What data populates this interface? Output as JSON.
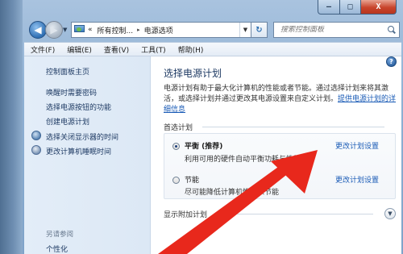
{
  "window": {
    "caption_buttons": {
      "minimize": "–",
      "maximize": "□",
      "close": "X"
    }
  },
  "address": {
    "prefix": "«",
    "crumbs": [
      "所有控制...",
      "电源选项"
    ],
    "separator": "▸",
    "search_placeholder": "搜索控制面板"
  },
  "menu": [
    "文件(F)",
    "编辑(E)",
    "查看(V)",
    "工具(T)",
    "帮助(H)"
  ],
  "sidebar": {
    "home": "控制面板主页",
    "links": [
      "唤醒时需要密码",
      "选择电源按钮的功能",
      "创建电源计划",
      "选择关闭显示器的时间",
      "更改计算机睡眠时间"
    ],
    "see_also": "另请参阅",
    "personalize": "个性化"
  },
  "main": {
    "title": "选择电源计划",
    "description": "电源计划有助于最大化计算机的性能或者节能。通过选择计划来将其激活，或选择计划并通过更改其电源设置来自定义计划。",
    "description_link": "提供电源计划的详细信息",
    "preferred_label": "首选计划",
    "plans": [
      {
        "name": "平衡 (推荐)",
        "desc": "利用可用的硬件自动平衡功耗与性能",
        "change": "更改计划设置",
        "selected": true
      },
      {
        "name": "节能",
        "desc": "尽可能降低计算机性能以节能",
        "change": "更改计划设置",
        "selected": false
      }
    ],
    "extra_label": "显示附加计划"
  },
  "colors": {
    "link": "#1a5bb6",
    "sidebar_text": "#1e3a63",
    "arrow": "#e8281c"
  }
}
